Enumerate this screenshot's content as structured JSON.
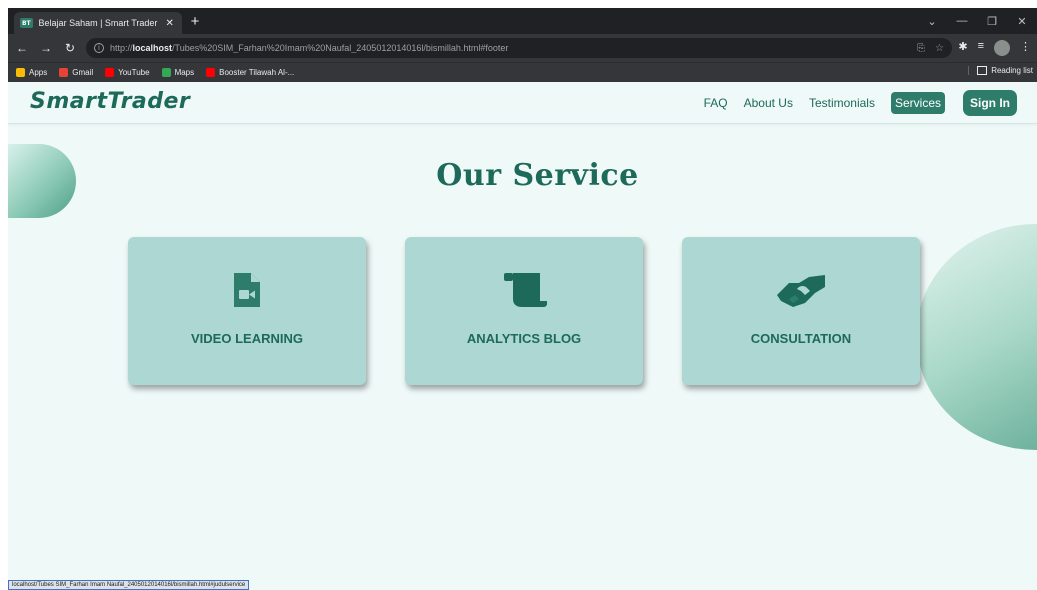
{
  "browser": {
    "tab_title": "Belajar Saham | Smart Trader",
    "tab_favicon_text": "BT",
    "url_prefix": "http://",
    "url_host": "localhost",
    "url_path": "/Tubes%20SIM_Farhan%20Imam%20Naufal_2405012014016l/bismillah.html#footer",
    "bookmarks": [
      {
        "label": "Apps",
        "color": "#fbbc04"
      },
      {
        "label": "Gmail",
        "color": "#ea4335"
      },
      {
        "label": "YouTube",
        "color": "#ff0000"
      },
      {
        "label": "Maps",
        "color": "#34a853"
      },
      {
        "label": "Booster Tilawah Al-...",
        "color": "#ff0000"
      }
    ],
    "reading_list": "Reading list"
  },
  "navbar": {
    "logo": "SmartTrader",
    "links": [
      "FAQ",
      "About Us",
      "Testimonials",
      "Services"
    ],
    "active_link": "Services",
    "signin": "Sign In"
  },
  "main": {
    "heading": "Our Service",
    "services": [
      {
        "label": "VIDEO LEARNING",
        "icon": "video-file-icon"
      },
      {
        "label": "ANALYTICS BLOG",
        "icon": "scroll-icon"
      },
      {
        "label": "CONSULTATION",
        "icon": "handshake-icon"
      }
    ]
  },
  "status_url": "localhost/Tubes SIM_Farhan Imam Naufal_2405012014016l/bismillah.html#judulservice",
  "colors": {
    "brand": "#1d6a5a",
    "accent": "#2e7d6b",
    "card": "#acd7d3",
    "page_bg": "#eef9f8"
  }
}
